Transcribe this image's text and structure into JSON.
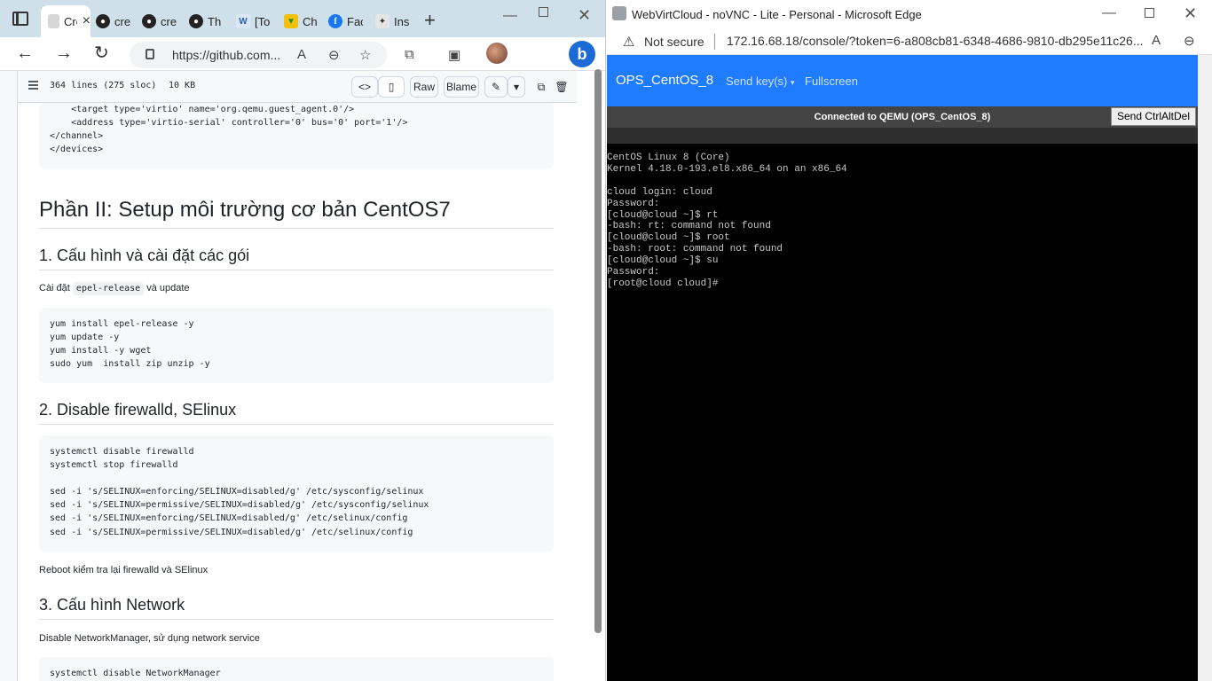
{
  "left_window": {
    "tabs": [
      {
        "label": "Cre",
        "icon": "app-icon"
      },
      {
        "label": "cre",
        "icon": "github-icon"
      },
      {
        "label": "cre",
        "icon": "github-icon"
      },
      {
        "label": "Th",
        "icon": "github-icon"
      },
      {
        "label": "[To",
        "icon": "w-icon"
      },
      {
        "label": "Ch",
        "icon": "shield-icon"
      },
      {
        "label": "Fac",
        "icon": "facebook-icon"
      },
      {
        "label": "Ins",
        "icon": "app-icon"
      }
    ],
    "url": "https://github.com...",
    "file_header": {
      "lines": "364 lines (275 sloc)",
      "size": "10 KB",
      "raw_label": "Raw",
      "blame_label": "Blame"
    },
    "page": {
      "code_top": [
        "    <target type='virtio' name='org.qemu.guest_agent.0'/>",
        "    <address type='virtio-serial' controller='0' bus='0' port='1'/>",
        "</channel>",
        "</devices>"
      ],
      "h1": "Phần II: Setup môi trường cơ bản CentOS7",
      "sec1_title": "1. Cấu hình và cài đặt các gói",
      "sec1_text_a": "Cài đặt",
      "sec1_inline": "epel-release",
      "sec1_text_b": "và update",
      "code_1": [
        "yum install epel-release -y",
        "yum update -y",
        "yum install -y wget",
        "sudo yum  install zip unzip -y"
      ],
      "sec2_title": "2. Disable firewalld, SElinux",
      "code_2": [
        "systemctl disable firewalld",
        "systemctl stop firewalld",
        "",
        "sed -i 's/SELINUX=enforcing/SELINUX=disabled/g' /etc/sysconfig/selinux",
        "sed -i 's/SELINUX=permissive/SELINUX=disabled/g' /etc/sysconfig/selinux",
        "sed -i 's/SELINUX=enforcing/SELINUX=disabled/g' /etc/selinux/config",
        "sed -i 's/SELINUX=permissive/SELINUX=disabled/g' /etc/selinux/config"
      ],
      "sec2_text": "Reboot kiểm tra lại firewalld và SElinux",
      "sec3_title": "3. Cấu hình Network",
      "sec3_text": "Disable NetworkManager, sử dụng network service",
      "code_3": [
        "systemctl disable NetworkManager"
      ]
    }
  },
  "right_window": {
    "title": "WebVirtCloud - noVNC - Lite - Personal - Microsoft Edge",
    "not_secure": "Not secure",
    "url": "172.16.68.18/console/?token=6-a808cb81-6348-4686-9810-db295e11c26...",
    "vnc": {
      "brand": "OPS_CentOS_8",
      "send_keys": "Send key(s)",
      "fullscreen": "Fullscreen",
      "status": "Connected to QEMU (OPS_CentOS_8)",
      "ctrl_alt_del": "Send CtrlAltDel"
    },
    "console_lines": [
      "CentOS Linux 8 (Core)",
      "Kernel 4.18.0-193.el8.x86_64 on an x86_64",
      "",
      "cloud login: cloud",
      "Password:",
      "[cloud@cloud ~]$ rt",
      "-bash: rt: command not found",
      "[cloud@cloud ~]$ root",
      "-bash: root: command not found",
      "[cloud@cloud ~]$ su",
      "Password:",
      "[root@cloud cloud]#"
    ]
  }
}
